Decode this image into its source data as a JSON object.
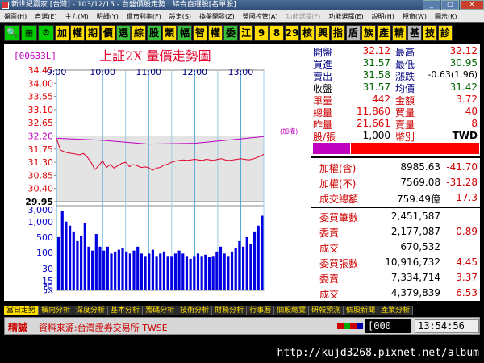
{
  "window": {
    "title": "新世紀贏家 [台灣] - 103/12/15 - 台盤價股走勢 : 綜合自選股[名單股]",
    "min": "_",
    "max": "□",
    "close": "✕"
  },
  "menu": [
    "盤面(H)",
    "自選(E)",
    "主力(M)",
    "明細(Y)",
    "還市利率(F)",
    "設定(S)",
    "換盤開發(Z)",
    "盟國控管(A)",
    "功能選擇(F)",
    "功能選擇(E)",
    "說明(H)",
    "視窗(W)",
    "圖示(K)"
  ],
  "toolbar": {
    "icons": [
      "search-icon",
      "grid-icon",
      "gear-icon"
    ],
    "buttons": [
      {
        "t": "加",
        "c": "yel"
      },
      {
        "t": "權",
        "c": "yel"
      },
      {
        "t": "期",
        "c": "yel"
      },
      {
        "t": "價",
        "c": "yel"
      },
      {
        "t": "選",
        "c": "grn"
      },
      {
        "t": "綜",
        "c": "yel"
      },
      {
        "t": "股",
        "c": "grn"
      },
      {
        "t": "類",
        "c": "yel"
      },
      {
        "t": "幅",
        "c": "grn"
      },
      {
        "t": "智",
        "c": "yel"
      },
      {
        "t": "權",
        "c": "yel"
      },
      {
        "t": "委",
        "c": "grn"
      },
      {
        "t": "江",
        "c": "yel"
      },
      {
        "t": "9",
        "c": "yel"
      },
      {
        "t": "8",
        "c": "yel"
      },
      {
        "t": "29",
        "c": "yel"
      },
      {
        "t": "核",
        "c": "yel"
      },
      {
        "t": "興",
        "c": "yel"
      },
      {
        "t": "指",
        "c": "yel"
      },
      {
        "t": "盾",
        "c": "gry"
      },
      {
        "t": "族",
        "c": "yel"
      },
      {
        "t": "產",
        "c": "yel"
      },
      {
        "t": "精",
        "c": "yel"
      },
      {
        "t": "基",
        "c": "gry"
      },
      {
        "t": "技",
        "c": "yel"
      },
      {
        "t": "診",
        "c": "yel"
      }
    ]
  },
  "chart_data": {
    "type": "line",
    "title": "上証2X 量價走勢圖",
    "code": "[00633L]",
    "ref_label": "(加權)",
    "price_ticks": [
      "34.45",
      "34.00",
      "33.55",
      "33.10",
      "32.65",
      "32.20",
      "31.75",
      "31.30",
      "30.85",
      "30.40",
      "29.95"
    ],
    "ref_tick": "32.20",
    "ylim": [
      29.95,
      34.45
    ],
    "volume_ticks": [
      "3,000",
      "1,000",
      "500",
      "100",
      "30",
      "15"
    ],
    "volume_unit": "張",
    "time_ticks": [
      "9:00",
      "10:00",
      "11:00",
      "12:00",
      "13:00"
    ],
    "xlim": [
      "9:00",
      "13:30"
    ],
    "grid": true,
    "series": [
      {
        "color": "#e0002a",
        "x": [
          "9:00",
          "9:05",
          "9:10",
          "9:15",
          "9:20",
          "9:25",
          "9:30",
          "9:35",
          "9:40",
          "9:45",
          "9:50",
          "9:55",
          "10:00",
          "10:05",
          "10:10",
          "10:15",
          "10:20",
          "10:25",
          "10:30",
          "10:35",
          "10:40",
          "10:45",
          "10:50",
          "10:55",
          "11:00",
          "11:05",
          "11:10",
          "11:15",
          "11:20",
          "11:25",
          "11:30",
          "11:35",
          "11:40",
          "11:45",
          "11:50",
          "11:55",
          "12:00",
          "12:05",
          "12:10",
          "12:15",
          "12:20",
          "12:25",
          "12:30",
          "12:35",
          "12:40",
          "12:45",
          "12:50",
          "12:55",
          "13:00",
          "13:05",
          "13:10",
          "13:15",
          "13:20",
          "13:25",
          "13:30"
        ],
        "values": [
          32.12,
          31.72,
          31.66,
          31.62,
          31.6,
          31.58,
          31.55,
          31.6,
          31.48,
          31.3,
          31.05,
          31.18,
          31.35,
          31.12,
          31.22,
          31.1,
          31.18,
          31.26,
          31.3,
          31.15,
          31.22,
          31.18,
          31.12,
          31.14,
          31.12,
          31.02,
          31.1,
          31.12,
          31.2,
          31.24,
          31.3,
          31.34,
          31.36,
          31.38,
          31.36,
          31.38,
          31.4,
          31.38,
          31.36,
          31.4,
          31.38,
          31.36,
          31.4,
          31.42,
          31.38,
          31.36,
          31.38,
          31.4,
          31.42,
          31.4,
          31.38,
          31.4,
          31.45,
          31.5,
          31.57
        ]
      },
      {
        "color": "#c000c0",
        "x": [
          "9:00",
          "10:00",
          "11:00",
          "12:00",
          "13:00",
          "13:30"
        ],
        "values": [
          32.12,
          32.05,
          31.92,
          31.95,
          32.1,
          32.18
        ]
      }
    ],
    "volume": [
      40,
      260,
      120,
      90,
      60,
      30,
      45,
      110,
      20,
      15,
      50,
      20,
      15,
      20,
      12,
      14,
      16,
      18,
      14,
      12,
      15,
      20,
      12,
      10,
      12,
      16,
      10,
      12,
      14,
      10,
      10,
      12,
      15,
      12,
      10,
      8,
      10,
      12,
      10,
      11,
      9,
      10,
      14,
      20,
      12,
      10,
      14,
      18,
      30,
      20,
      40,
      25,
      60,
      90,
      180
    ]
  },
  "quote": {
    "open_l": "開盤",
    "open": "32.12",
    "high_l": "最高",
    "high": "32.12",
    "bid_l": "買進",
    "bid": "31.57",
    "low_l": "最低",
    "low": "30.95",
    "ask_l": "賣出",
    "ask": "31.58",
    "chg_l": "漲跌",
    "chg": "-0.63(1.96)",
    "close_l": "收盤",
    "close": "31.57",
    "avg_l": "均價",
    "avg": "31.42",
    "unit_l": "單量",
    "unit": "442",
    "amt_l": "金額",
    "amt": "3.72",
    "vol_l": "總量",
    "vol": "11,860",
    "bvol_l": "買量",
    "bvol": "40",
    "yvol_l": "昨量",
    "yvol": "21,661",
    "svol_l": "賣量",
    "svol": "8",
    "share_l": "股/張",
    "share": "1,000",
    "cur_l": "幣別",
    "cur": "TWD"
  },
  "index": [
    {
      "l": "加權(含)",
      "v1": "8985.63",
      "v2": "-41.70"
    },
    {
      "l": "加權(不)",
      "v1": "7569.08",
      "v2": "-31.28"
    },
    {
      "l": "成交總額",
      "v1": "759.49億",
      "v2": "17.3"
    }
  ],
  "orders": [
    {
      "l": "委買筆數",
      "v1": "2,451,587",
      "v2": ""
    },
    {
      "l": "委賣",
      "v1": "2,177,087",
      "v2": "0.89"
    },
    {
      "l": "成交",
      "v1": "670,532",
      "v2": ""
    },
    {
      "l": "委買張數",
      "v1": "10,916,732",
      "v2": "4.45"
    },
    {
      "l": "委賣",
      "v1": "7,334,714",
      "v2": "3.37"
    },
    {
      "l": "成交",
      "v1": "4,379,839",
      "v2": "6.53"
    }
  ],
  "tabs": [
    "當日走勢",
    "橫向分析",
    "深度分析",
    "基本分析",
    "籌碼分析",
    "技術分析",
    "財務分析",
    "行事曆",
    "個股總覽",
    "研報預測",
    "個股新聞",
    "產業分析"
  ],
  "status": {
    "jc": "精誠",
    "source": "資料來源:台灣證券交易所 TWSE.",
    "input": "[000",
    "time": "13:54:56"
  },
  "footer": {
    "url": "http://kujd3268.pixnet.net/album"
  }
}
